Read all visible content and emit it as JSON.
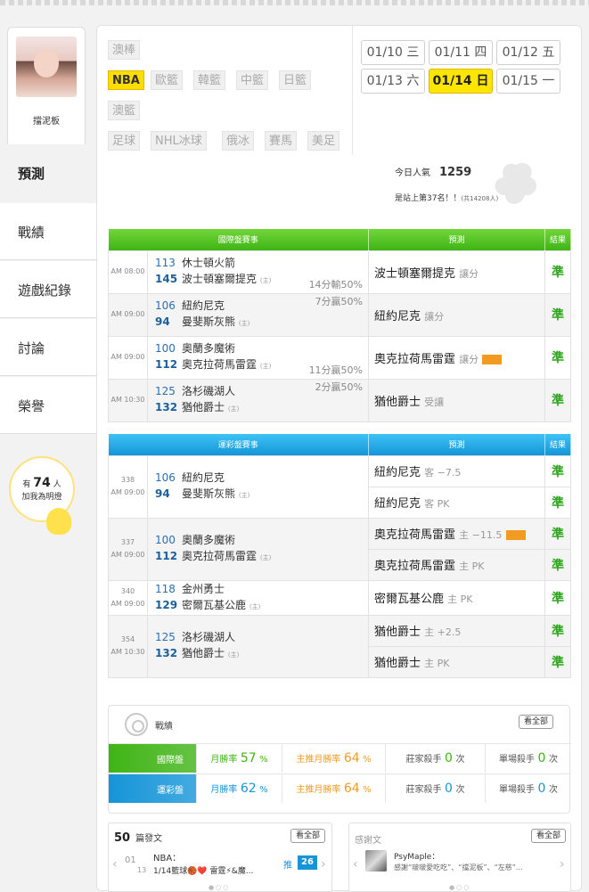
{
  "profile": {
    "name": "擋泥板"
  },
  "nav": [
    "預測",
    "戰績",
    "遊戲紀錄",
    "討論",
    "榮譽"
  ],
  "fans": {
    "prefix": "有",
    "count": "74",
    "suffix": "人",
    "line2": "加我為明燈"
  },
  "leagues": [
    [
      "澳棒"
    ],
    [
      "NBA",
      "歐籃",
      "韓籃",
      "中籃",
      "日籃"
    ],
    [
      "澳籃"
    ],
    [
      "足球",
      "NHL冰球",
      "俄冰",
      "賽馬",
      "美足"
    ]
  ],
  "dates": [
    [
      "01/10 三",
      "01/11 四",
      "01/12 五"
    ],
    [
      "01/13 六",
      "01/14 日",
      "01/15 一"
    ]
  ],
  "popularity": {
    "label": "今日人氣",
    "value": "1259",
    "rank": "是站上第37名！！",
    "total": "(共14208人)"
  },
  "intl": {
    "h1": "國際盤賽事",
    "h2": "預測",
    "h3": "結果",
    "rows": [
      {
        "time": "AM 08:00",
        "n1": "113",
        "t1": "休士頓火箭",
        "n2": "145",
        "t2": "波士頓塞爾提克",
        "home": "(主)",
        "odds": "14分輸50%",
        "pick": "波士頓塞爾提克",
        "pt": "讓分",
        "res": "準"
      },
      {
        "time": "AM 09:00",
        "n1": "106",
        "t1": "紐約尼克",
        "n2": "94",
        "t2": "曼斐斯灰熊",
        "home": "(主)",
        "odds": "7分贏50%",
        "pick": "紐約尼克",
        "pt": "讓分",
        "res": "準"
      },
      {
        "time": "AM 09:00",
        "n1": "100",
        "t1": "奧蘭多魔術",
        "n2": "112",
        "t2": "奧克拉荷馬雷霆",
        "home": "(主)",
        "odds": "11分贏50%",
        "pick": "奧克拉荷馬雷霆",
        "pt": "讓分",
        "res": "準"
      },
      {
        "time": "AM 10:30",
        "n1": "125",
        "t1": "洛杉磯湖人",
        "n2": "132",
        "t2": "猶他爵士",
        "home": "(主)",
        "odds": "2分贏50%",
        "pick": "猶他爵士",
        "pt": "受讓",
        "res": "準"
      }
    ]
  },
  "lottery": {
    "h1": "運彩盤賽事",
    "h2": "預測",
    "h3": "結果",
    "rows": [
      {
        "id": "338",
        "time": "AM 09:00",
        "n1": "106",
        "t1": "紐約尼克",
        "n2": "94",
        "t2": "曼斐斯灰熊",
        "home": "(主)",
        "p1": "紐約尼克",
        "p1t": "客 −7.5",
        "r1": "準",
        "p2": "紐約尼克",
        "p2t": "客 PK",
        "r2": "準"
      },
      {
        "id": "337",
        "time": "AM 09:00",
        "n1": "100",
        "t1": "奧蘭多魔術",
        "n2": "112",
        "t2": "奧克拉荷馬雷霆",
        "home": "(主)",
        "p1": "奧克拉荷馬雷霆",
        "p1t": "主 −11.5",
        "r1": "準",
        "p2": "奧克拉荷馬雷霆",
        "p2t": "主 PK",
        "r2": "準"
      },
      {
        "id": "340",
        "time": "AM 09:00",
        "n1": "118",
        "t1": "金州勇士",
        "n2": "129",
        "t2": "密爾瓦基公鹿",
        "home": "(主)",
        "p1": "密爾瓦基公鹿",
        "p1t": "主 PK",
        "r1": "準"
      },
      {
        "id": "354",
        "time": "AM 10:30",
        "n1": "125",
        "t1": "洛杉磯湖人",
        "n2": "132",
        "t2": "猶他爵士",
        "home": "(主)",
        "p1": "猶他爵士",
        "p1t": "主 +2.5",
        "r1": "準",
        "p2": "猶他爵士",
        "p2t": "主 PK",
        "r2": "準"
      }
    ]
  },
  "record": {
    "title": "戰績",
    "all": "看全部",
    "rows": [
      {
        "label": "國際盤",
        "c1k": "月勝率",
        "c1v": "57",
        "c2k": "主推月勝率",
        "c2v": "64",
        "c3k": "莊家殺手",
        "c3v": "0",
        "c4k": "單場殺手",
        "c4v": "0"
      },
      {
        "label": "運彩盤",
        "c1k": "月勝率",
        "c1v": "62",
        "c2k": "主推月勝率",
        "c2v": "64",
        "c3k": "莊家殺手",
        "c3v": "0",
        "c4k": "單場殺手",
        "c4v": "0"
      }
    ],
    "pct": "%",
    "unit": "次"
  },
  "posts": {
    "count": "50",
    "label": "篇發文",
    "all": "看全部",
    "date1": "01",
    "date2": "13",
    "title": "NBA：",
    "line": "1/14籃球🏀❤️ 雷霆⚡&魔...",
    "push": "推",
    "pushn": "26"
  },
  "thanks": {
    "label": "感謝文",
    "all": "看全部",
    "user": "PsyMaple：",
    "line": "感謝“啵啵愛吃吃”、“擋泥板”、“左慈”..."
  },
  "colors": {
    "green": "#3fb415",
    "blue": "#1595d8",
    "orange": "#f39a20",
    "yellow": "#ffe600"
  }
}
